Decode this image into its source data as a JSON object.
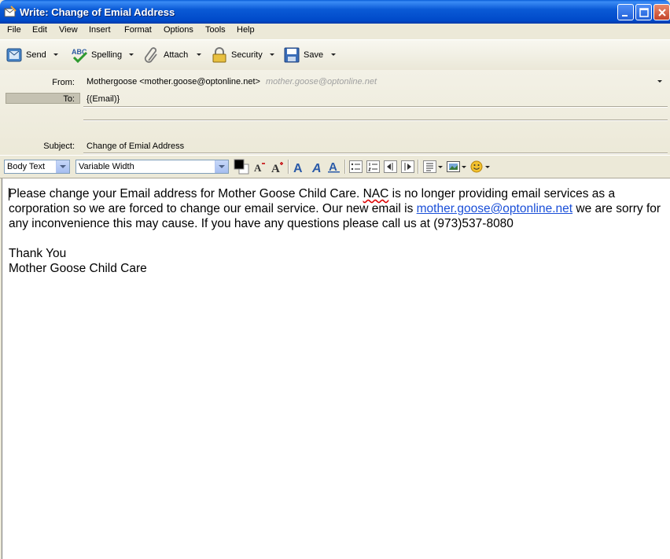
{
  "window": {
    "title": "Write: Change of Emial Address"
  },
  "menu": [
    "File",
    "Edit",
    "View",
    "Insert",
    "Format",
    "Options",
    "Tools",
    "Help"
  ],
  "toolbar": {
    "send": "Send",
    "spelling": "Spelling",
    "attach": "Attach",
    "security": "Security",
    "save": "Save"
  },
  "headers": {
    "from_label": "From:",
    "from_value": "Mothergoose <mother.goose@optonline.net>",
    "from_account": "mother.goose@optonline.net",
    "to_label": "To:",
    "to_value": "{(Email)}",
    "subject_label": "Subject:",
    "subject_value": "Change of Emial Address"
  },
  "format": {
    "paragraph_style": "Body Text",
    "font": "Variable Width",
    "text_color": "#000000",
    "background_color": "#ffffff"
  },
  "message": {
    "para1_a": "Please change your Email address for Mother Goose Child Care.  ",
    "para1_nac": "NAC",
    "para1_b": " is no longer providing email services as a corporation so we are forced to change our email service.  Our new email is ",
    "para1_link": "mother.goose@optonline.net",
    "para1_c": " we are sorry for any inconvenience this may cause.  If you have any questions please call us at (973)537-8080",
    "closing1": "Thank You",
    "closing2": "Mother Goose Child Care"
  },
  "colors": {
    "titlebar": "#0a5ad6",
    "link": "#1a4fd8",
    "spell_error": "#dd0000"
  }
}
